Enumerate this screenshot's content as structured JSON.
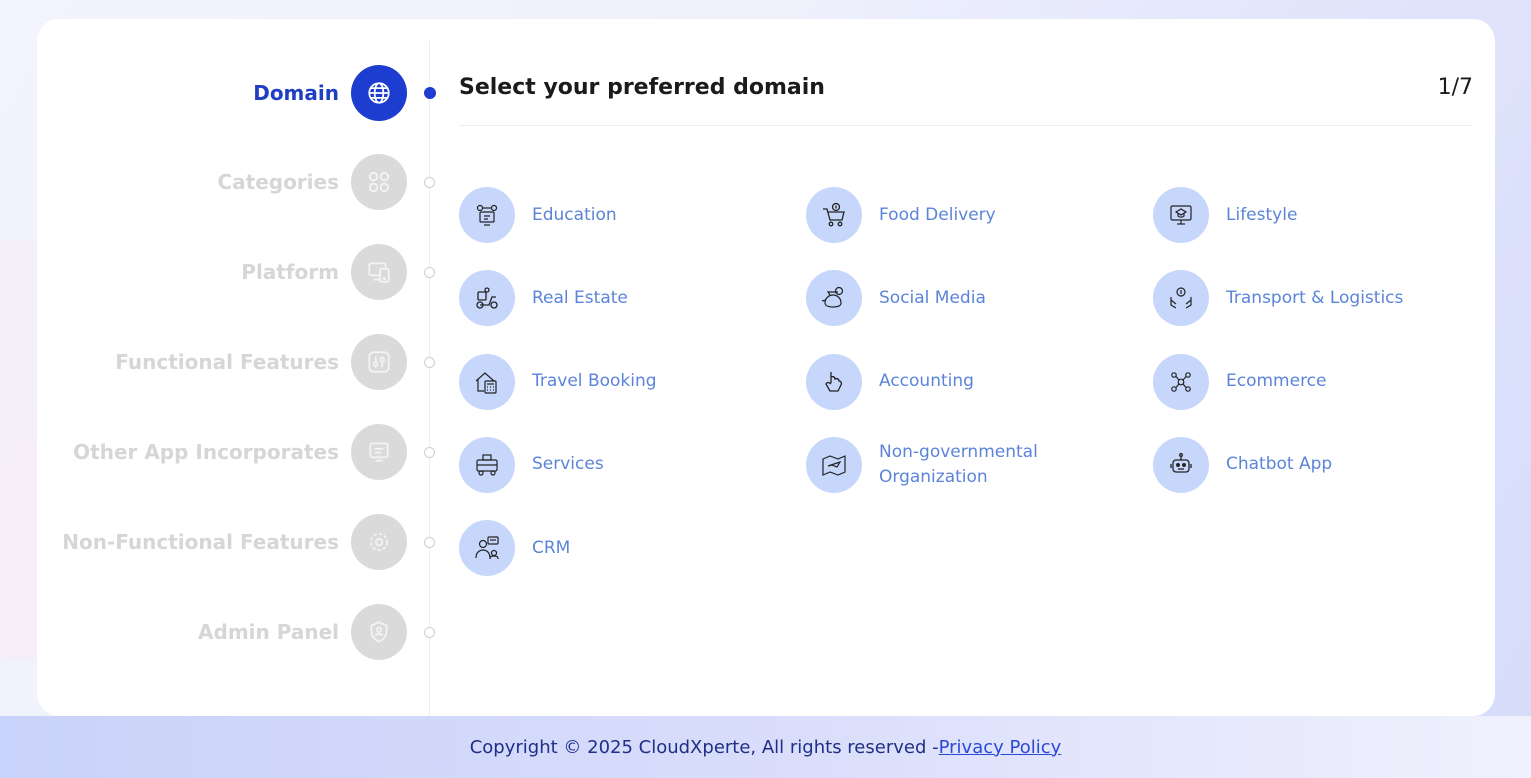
{
  "steps": [
    {
      "label": "Domain",
      "icon": "globe-icon",
      "active": true
    },
    {
      "label": "Categories",
      "icon": "grid-icon",
      "active": false
    },
    {
      "label": "Platform",
      "icon": "devices-icon",
      "active": false
    },
    {
      "label": "Functional Features",
      "icon": "sliders-icon",
      "active": false
    },
    {
      "label": "Other App Incorporates",
      "icon": "chat-box-icon",
      "active": false
    },
    {
      "label": "Non-Functional Features",
      "icon": "settings-gear-icon",
      "active": false
    },
    {
      "label": "Admin Panel",
      "icon": "shield-user-icon",
      "active": false
    }
  ],
  "header": {
    "title": "Select your preferred domain",
    "progress": "1/7"
  },
  "domains": [
    {
      "label": "Education",
      "icon": "education-icon"
    },
    {
      "label": "Food Delivery",
      "icon": "shopping-cart-icon"
    },
    {
      "label": "Lifestyle",
      "icon": "online-learning-icon"
    },
    {
      "label": "Real Estate",
      "icon": "delivery-scooter-icon"
    },
    {
      "label": "Social Media",
      "icon": "money-bag-icon"
    },
    {
      "label": "Transport & Logistics",
      "icon": "hand-coin-icon"
    },
    {
      "label": "Travel Booking",
      "icon": "house-calculator-icon"
    },
    {
      "label": "Accounting",
      "icon": "hand-touch-icon"
    },
    {
      "label": "Ecommerce",
      "icon": "network-people-icon"
    },
    {
      "label": "Services",
      "icon": "bus-icon"
    },
    {
      "label": "Non-governmental Organization",
      "icon": "map-plane-icon"
    },
    {
      "label": "Chatbot App",
      "icon": "robot-icon"
    },
    {
      "label": "CRM",
      "icon": "customer-support-icon"
    }
  ],
  "footer": {
    "copyright": "Copyright © 2025 CloudXperte, All rights reserved -",
    "privacy_link": "Privacy Policy"
  },
  "colors": {
    "accent": "#1d3cd0",
    "inactive_step": "#dadada",
    "domain_icon_bg": "#c7d7fb",
    "domain_text": "#5b84d9"
  }
}
